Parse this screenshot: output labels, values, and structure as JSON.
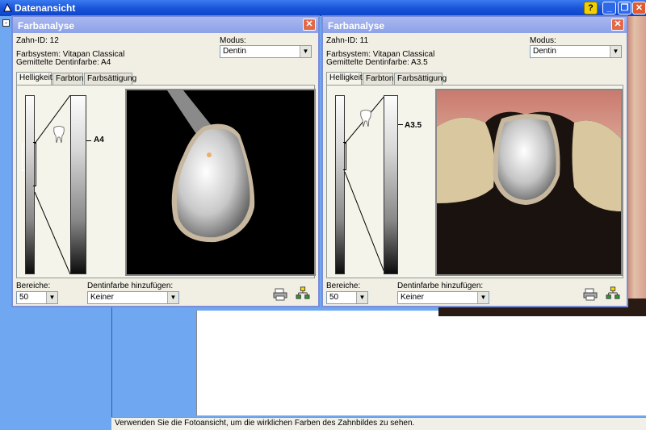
{
  "app": {
    "title": "Datenansicht",
    "help_label": "?",
    "min_label": "_",
    "max_label": "❐",
    "close_label": "✕"
  },
  "status_text": "Verwenden Sie die Fotoansicht, um die wirklichen Farben des Zahnbildes zu sehen.",
  "dialogs": [
    {
      "title": "Farbanalyse",
      "tooth_id": "Zahn-ID: 12",
      "color_system": "Farbsystem: Vitapan Classical",
      "avg_dentin": "Gemittelte Dentinfarbe: A4",
      "mode_label": "Modus:",
      "mode_value": "Dentin",
      "tabs": [
        "Helligkeit",
        "Farbton",
        "Farbsättigung"
      ],
      "scale_label": "A4",
      "areas_label": "Bereiche:",
      "areas_value": "50",
      "add_dentin_label": "Dentinfarbe hinzufügen:",
      "add_dentin_value": "Keiner"
    },
    {
      "title": "Farbanalyse",
      "tooth_id": "Zahn-ID: 11",
      "color_system": "Farbsystem: Vitapan Classical",
      "avg_dentin": "Gemittelte Dentinfarbe: A3.5",
      "mode_label": "Modus:",
      "mode_value": "Dentin",
      "tabs": [
        "Helligkeit",
        "Farbton",
        "Farbsättigung"
      ],
      "scale_label": "A3.5",
      "areas_label": "Bereiche:",
      "areas_value": "50",
      "add_dentin_label": "Dentinfarbe hinzufügen:",
      "add_dentin_value": "Keiner"
    }
  ],
  "icons": [
    "window-icon",
    "printer-icon",
    "network-icon",
    "tooth-icon"
  ]
}
